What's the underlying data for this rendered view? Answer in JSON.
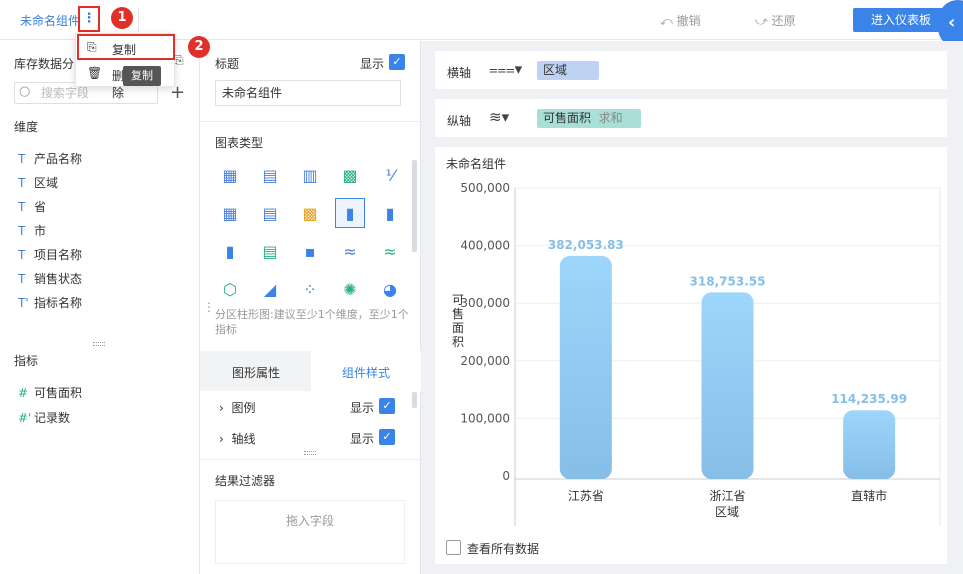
{
  "header": {
    "tab_title": "未命名组件",
    "more_glyph": "⋮",
    "undo_label": "撤销",
    "redo_label": "还原",
    "enter_dashboard_label": "进入仪表板",
    "markers": [
      "1",
      "2"
    ]
  },
  "context_menu": {
    "items": [
      {
        "label": "复制",
        "icon": "copy-icon"
      },
      {
        "label": "删除",
        "icon": "trash-icon"
      }
    ],
    "tooltip": "复制"
  },
  "data_panel": {
    "title": "库存数据分",
    "search_placeholder": "搜索字段",
    "dimensions_title": "维度",
    "dimensions": [
      "产品名称",
      "区域",
      "省",
      "市",
      "项目名称",
      "销售状态",
      "指标名称"
    ],
    "measures_title": "指标",
    "measures": [
      "可售面积",
      "记录数"
    ]
  },
  "config_panel": {
    "title_label": "标题",
    "show_label": "显示",
    "title_value": "未命名组件",
    "chart_type_label": "图表类型",
    "chart_hint": "分区柱形图:建议至少1个维度，至少1个指标",
    "tabs": [
      "图形属性",
      "组件样式"
    ],
    "rows": [
      {
        "label": "图例",
        "show": "显示"
      },
      {
        "label": "轴线",
        "show": "显示"
      }
    ],
    "filter_title": "结果过滤器",
    "filter_drop": "拖入字段"
  },
  "axes": {
    "x_label": "横轴",
    "x_field": "区域",
    "y_label": "纵轴",
    "y_field": "可售面积",
    "y_agg": "求和"
  },
  "chart_card": {
    "title": "未命名组件",
    "view_all_label": "查看所有数据"
  },
  "colors": {
    "accent": "#3a83e8",
    "bar_top": "#9dd6fa",
    "bar_bottom": "#85bfe8",
    "data_label": "#85bfe8",
    "marker": "#e0302a"
  },
  "chart_data": {
    "type": "bar",
    "categories": [
      "江苏省",
      "浙江省",
      "直辖市"
    ],
    "values": [
      382053.83,
      318753.55,
      114235.99
    ],
    "value_labels": [
      "382,053.83",
      "318,753.55",
      "114,235.99"
    ],
    "xlabel": "区域",
    "ylabel": "可售面积",
    "ylim": [
      0,
      500000
    ],
    "yticks": [
      "0",
      "100,000",
      "200,000",
      "300,000",
      "400,000",
      "500,000"
    ],
    "grid": true
  }
}
